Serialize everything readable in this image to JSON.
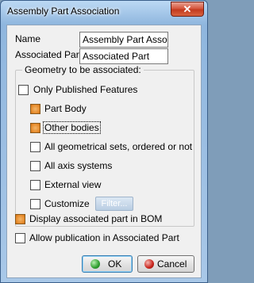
{
  "window": {
    "title": "Assembly Part Association",
    "close_glyph": "✕"
  },
  "fields": {
    "name_label": "Name",
    "name_value": "Assembly Part Assoc",
    "associated_label": "Associated Part",
    "associated_value": "Associated Part"
  },
  "geometry": {
    "title": "Geometry to be associated:",
    "only_published": {
      "label": "Only Published Features",
      "checked": false
    },
    "part_body": {
      "label": "Part Body",
      "checked": true
    },
    "other_bodies": {
      "label": "Other bodies",
      "checked": true
    },
    "all_geometrical_sets": {
      "label": "All geometrical sets, ordered or not",
      "checked": false
    },
    "all_axis_systems": {
      "label": "All axis systems",
      "checked": false
    },
    "external_view": {
      "label": "External view",
      "checked": false
    },
    "customize": {
      "label": "Customize",
      "checked": false
    },
    "filter_button": "Filter..."
  },
  "options": {
    "display_in_bom": {
      "label": "Display associated part in BOM",
      "checked": true
    },
    "allow_publication": {
      "label": "Allow publication in Associated Part",
      "checked": false
    }
  },
  "buttons": {
    "ok": "OK",
    "cancel": "Cancel"
  },
  "colors": {
    "checked": "#e68a2b",
    "ok_icon": "#2e9e2e",
    "cancel_icon": "#c8231b"
  }
}
